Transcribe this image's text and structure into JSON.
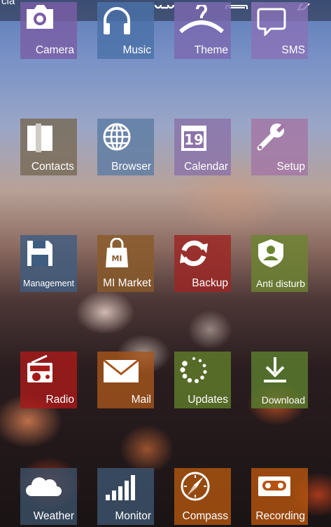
{
  "status_bar": {
    "text": "cia",
    "icons": [
      "share-icon",
      "screen-icon",
      "edit-icon"
    ]
  },
  "apps": [
    {
      "label": "Camera",
      "icon": "camera-icon",
      "color": "#7a5ea6"
    },
    {
      "label": "Music",
      "icon": "headphones-icon",
      "color": "#4a72a8"
    },
    {
      "label": "Theme",
      "icon": "hanger-icon",
      "color": "#7b69b0"
    },
    {
      "label": "SMS",
      "icon": "speech-bubble-icon",
      "color": "#8972b7"
    },
    {
      "label": "Contacts",
      "icon": "contact-card-icon",
      "color": "#786a55"
    },
    {
      "label": "Browser",
      "icon": "globe-icon",
      "color": "#5e7da4"
    },
    {
      "label": "Calendar",
      "icon": "calendar-icon",
      "color": "#8b73a8",
      "badge": "19"
    },
    {
      "label": "Setup",
      "icon": "wrench-icon",
      "color": "#a376a5"
    },
    {
      "label": "Management",
      "icon": "floppy-disk-icon",
      "color": "#3f5d80"
    },
    {
      "label": "MI Market",
      "icon": "shopping-bag-icon",
      "color": "#8a5a2a",
      "badge": "MI"
    },
    {
      "label": "Backup",
      "icon": "sync-icon",
      "color": "#9c2625"
    },
    {
      "label": "Anti disturb",
      "icon": "shield-user-icon",
      "color": "#6b8431"
    },
    {
      "label": "Radio",
      "icon": "radio-icon",
      "color": "#a81a1a"
    },
    {
      "label": "Mail",
      "icon": "envelope-icon",
      "color": "#a4541b"
    },
    {
      "label": "Updates",
      "icon": "loading-dots-icon",
      "color": "#5f7d2a"
    },
    {
      "label": "Download",
      "icon": "download-icon",
      "color": "#5c7e2e"
    },
    {
      "label": "Weather",
      "icon": "cloud-icon",
      "color": "#3a5168"
    },
    {
      "label": "Monitor",
      "icon": "signal-bars-icon",
      "color": "#3d546e"
    },
    {
      "label": "Compass",
      "icon": "compass-icon",
      "color": "#b0550f"
    },
    {
      "label": "Recording",
      "icon": "cassette-icon",
      "color": "#b5540f"
    }
  ]
}
